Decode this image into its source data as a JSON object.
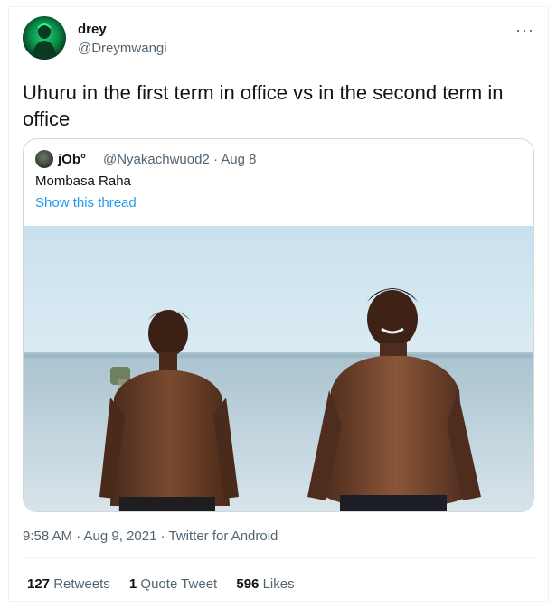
{
  "author": {
    "display_name": "drey",
    "handle": "@Dreymwangi",
    "more_label": "···"
  },
  "tweet": {
    "text": "Uhuru in the first term in office vs in the second term in office"
  },
  "quoted": {
    "name": "jOb°",
    "meta": "@Nyakachwuod2 · Aug 8",
    "text": "Mombasa Raha",
    "thread_link": "Show this thread"
  },
  "footer": {
    "timestamp": "9:58 AM · Aug 9, 2021 · Twitter for Android",
    "retweets_count": "127",
    "retweets_label": "Retweets",
    "quotes_count": "1",
    "quotes_label": "Quote Tweet",
    "likes_count": "596",
    "likes_label": "Likes"
  },
  "colors": {
    "link": "#1d9bf0",
    "secondary_text": "#536471",
    "border": "#cfd9de"
  }
}
